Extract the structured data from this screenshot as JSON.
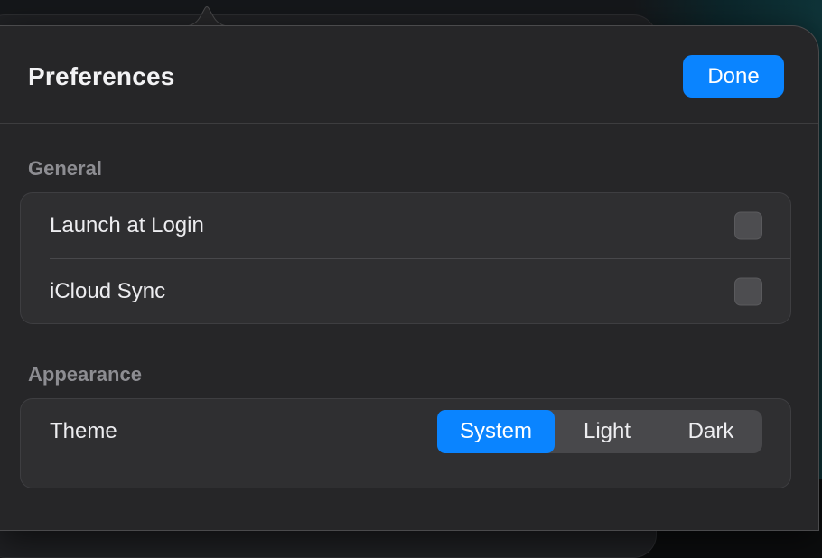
{
  "header": {
    "title": "Preferences",
    "done_label": "Done"
  },
  "sections": {
    "general": {
      "label": "General",
      "rows": [
        {
          "label": "Launch at Login",
          "checked": false
        },
        {
          "label": "iCloud Sync",
          "checked": false
        }
      ]
    },
    "appearance": {
      "label": "Appearance",
      "theme": {
        "label": "Theme",
        "options": [
          "System",
          "Light",
          "Dark"
        ],
        "selected": "System"
      }
    }
  },
  "colors": {
    "accent": "#0a84ff",
    "panel": "#262628",
    "group": "#2f2f31"
  },
  "icons": {
    "popover_arrow": "popover-arrow-icon"
  }
}
